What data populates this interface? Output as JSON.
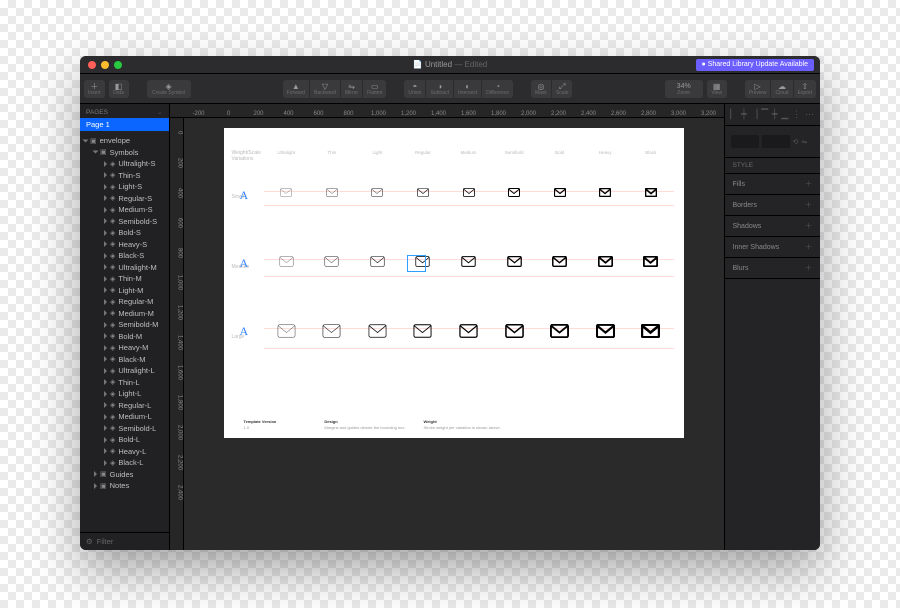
{
  "window": {
    "title": "Untitled",
    "title_suffix": "Edited",
    "library_update_banner": "Shared Library Update Available"
  },
  "toolbar": {
    "insert": "Insert",
    "data": "Data",
    "create_symbol": "Create Symbol",
    "forward": "Forward",
    "backward": "Backward",
    "mirror": "Mirror",
    "flatten": "Flatten",
    "union": "Union",
    "subtract": "Subtract",
    "intersect": "Intersect",
    "difference": "Difference",
    "mask": "Mask",
    "scale": "Scale",
    "zoom_value": "34%",
    "zoom": "Zoom",
    "view": "View",
    "preview": "Preview",
    "cloud": "Cloud",
    "export": "Export"
  },
  "ruler": {
    "top": [
      "-200",
      "0",
      "200",
      "400",
      "600",
      "800",
      "1,000",
      "1,200",
      "1,400",
      "1,600",
      "1,800",
      "2,000",
      "2,200",
      "2,400",
      "2,600",
      "2,800",
      "3,000",
      "3,200"
    ],
    "left": [
      "0",
      "200",
      "400",
      "600",
      "800",
      "1,000",
      "1,200",
      "1,400",
      "1,600",
      "1,800",
      "2,000",
      "2,200",
      "2,400"
    ]
  },
  "sidebar": {
    "pages_header": "PAGES",
    "pages": [
      "Page 1"
    ],
    "layers": [
      {
        "depth": 0,
        "open": true,
        "icon": "folder",
        "label": "envelope"
      },
      {
        "depth": 1,
        "open": true,
        "icon": "folder",
        "label": "Symbols"
      },
      {
        "depth": 2,
        "open": false,
        "icon": "sym",
        "label": "Ultralight-S"
      },
      {
        "depth": 2,
        "open": false,
        "icon": "sym",
        "label": "Thin-S"
      },
      {
        "depth": 2,
        "open": false,
        "icon": "sym",
        "label": "Light-S"
      },
      {
        "depth": 2,
        "open": false,
        "icon": "sym",
        "label": "Regular-S"
      },
      {
        "depth": 2,
        "open": false,
        "icon": "sym",
        "label": "Medium-S"
      },
      {
        "depth": 2,
        "open": false,
        "icon": "sym",
        "label": "Semibold-S"
      },
      {
        "depth": 2,
        "open": false,
        "icon": "sym",
        "label": "Bold-S"
      },
      {
        "depth": 2,
        "open": false,
        "icon": "sym",
        "label": "Heavy-S"
      },
      {
        "depth": 2,
        "open": false,
        "icon": "sym",
        "label": "Black-S"
      },
      {
        "depth": 2,
        "open": false,
        "icon": "sym",
        "label": "Ultralight-M"
      },
      {
        "depth": 2,
        "open": false,
        "icon": "sym",
        "label": "Thin-M"
      },
      {
        "depth": 2,
        "open": false,
        "icon": "sym",
        "label": "Light-M"
      },
      {
        "depth": 2,
        "open": false,
        "icon": "sym",
        "label": "Regular-M"
      },
      {
        "depth": 2,
        "open": false,
        "icon": "sym",
        "label": "Medium-M"
      },
      {
        "depth": 2,
        "open": false,
        "icon": "sym",
        "label": "Semibold-M"
      },
      {
        "depth": 2,
        "open": false,
        "icon": "sym",
        "label": "Bold-M"
      },
      {
        "depth": 2,
        "open": false,
        "icon": "sym",
        "label": "Heavy-M"
      },
      {
        "depth": 2,
        "open": false,
        "icon": "sym",
        "label": "Black-M"
      },
      {
        "depth": 2,
        "open": false,
        "icon": "sym",
        "label": "Ultralight-L"
      },
      {
        "depth": 2,
        "open": false,
        "icon": "sym",
        "label": "Thin-L"
      },
      {
        "depth": 2,
        "open": false,
        "icon": "sym",
        "label": "Light-L"
      },
      {
        "depth": 2,
        "open": false,
        "icon": "sym",
        "label": "Regular-L"
      },
      {
        "depth": 2,
        "open": false,
        "icon": "sym",
        "label": "Medium-L"
      },
      {
        "depth": 2,
        "open": false,
        "icon": "sym",
        "label": "Semibold-L"
      },
      {
        "depth": 2,
        "open": false,
        "icon": "sym",
        "label": "Bold-L"
      },
      {
        "depth": 2,
        "open": false,
        "icon": "sym",
        "label": "Heavy-L"
      },
      {
        "depth": 2,
        "open": false,
        "icon": "sym",
        "label": "Black-L"
      },
      {
        "depth": 1,
        "open": false,
        "icon": "folder",
        "label": "Guides"
      },
      {
        "depth": 1,
        "open": false,
        "icon": "folder",
        "label": "Notes"
      }
    ],
    "filter_placeholder": "Filter"
  },
  "artboard": {
    "weight_header_label": "Weight/Scale Variations",
    "column_headers": [
      "Ultralight",
      "Thin",
      "Light",
      "Regular",
      "Medium",
      "Semibold",
      "Bold",
      "Heavy",
      "Black"
    ],
    "row_labels": [
      "Small",
      "Medium",
      "Large"
    ],
    "weights": [
      0.5,
      0.7,
      0.9,
      1.2,
      1.6,
      2.0,
      2.4,
      2.8,
      3.3
    ],
    "meta": {
      "template_version_label": "Template Version",
      "template_version_value": "1.0",
      "design_label": "Design",
      "design_note": "Margins and guides denote the bounding box.",
      "weight_label": "Weight",
      "weight_note": "Stroke weight per variation is shown above."
    }
  },
  "inspector": {
    "style_header": "STYLE",
    "fills": "Fills",
    "borders": "Borders",
    "shadows": "Shadows",
    "inner_shadows": "Inner Shadows",
    "blurs": "Blurs"
  }
}
